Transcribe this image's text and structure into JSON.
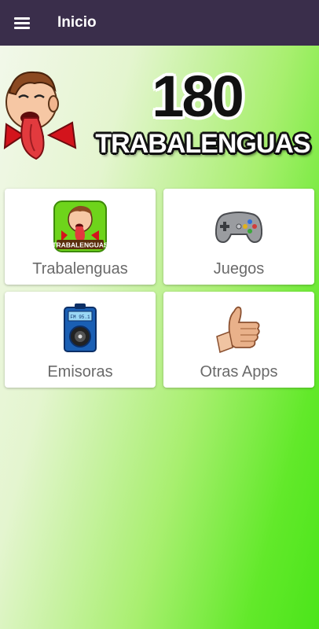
{
  "appbar": {
    "title": "Inicio",
    "menu_icon": "hamburger-menu-icon"
  },
  "banner": {
    "number": "180",
    "word": "TRABALENGUAS"
  },
  "tiles": [
    {
      "label": "Trabalenguas",
      "icon": "trabalenguas-app-icon",
      "icon_caption": "TRABALENGUAS"
    },
    {
      "label": "Juegos",
      "icon": "gamepad-icon"
    },
    {
      "label": "Emisoras",
      "icon": "radio-icon"
    },
    {
      "label": "Otras Apps",
      "icon": "thumbs-up-icon"
    }
  ],
  "colors": {
    "appbar": "#3a2e4b",
    "accent_green": "#4be51a",
    "tile_text": "#6a6a6a"
  }
}
